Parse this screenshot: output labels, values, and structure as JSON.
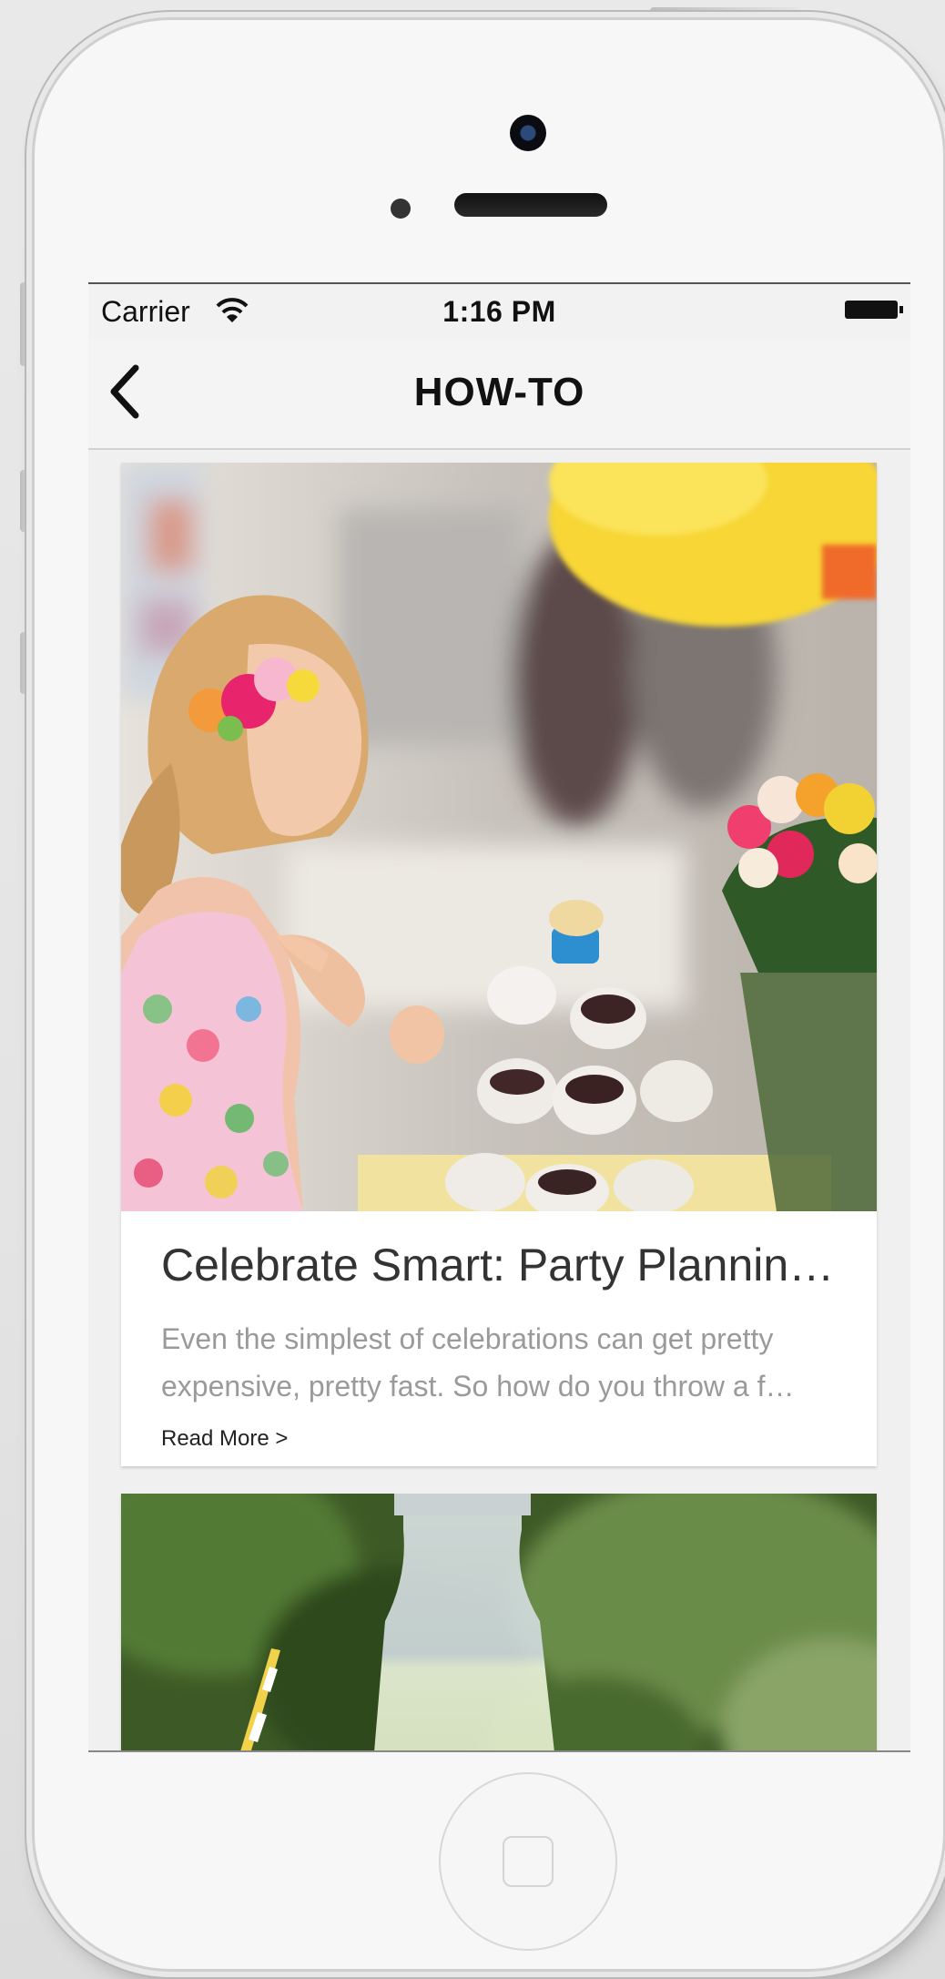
{
  "status_bar": {
    "carrier": "Carrier",
    "time": "1:16 PM",
    "wifi_icon": "wifi-icon",
    "battery_icon": "battery-icon"
  },
  "nav": {
    "title": "HOW-TO",
    "back_icon": "chevron-left-icon"
  },
  "articles": [
    {
      "title": "Celebrate Smart: Party Plannin…",
      "description_line1": "Even the simplest of celebrations can get pretty",
      "description_line2": "expensive, pretty fast. So how do you throw a f…",
      "read_more": "Read More >"
    }
  ],
  "colors": {
    "screen_background": "#f2f2f2",
    "card_background": "#ffffff",
    "title_text": "#333333",
    "description_text": "#9a9a9a"
  }
}
